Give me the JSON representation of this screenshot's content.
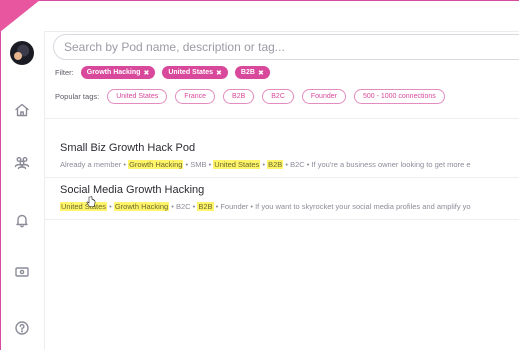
{
  "search": {
    "placeholder": "Search by Pod name, description or tag..."
  },
  "filters": {
    "label": "Filter:",
    "active": [
      "Growth Hacking",
      "United States",
      "B2B"
    ],
    "remove_glyph": "✖"
  },
  "popular": {
    "label": "Popular tags:",
    "tags": [
      "United States",
      "France",
      "B2B",
      "B2C",
      "Founder",
      "500 - 1000 connections"
    ]
  },
  "results": [
    {
      "title": "Small Biz Growth Hack Pod",
      "meta": [
        {
          "text": "Already a member • ",
          "hl": false
        },
        {
          "text": "Growth Hacking",
          "hl": true
        },
        {
          "text": " • SMB • ",
          "hl": false
        },
        {
          "text": "United States",
          "hl": true
        },
        {
          "text": " • ",
          "hl": false
        },
        {
          "text": "B2B",
          "hl": true
        },
        {
          "text": " • B2C • If you're a business owner looking to get more e",
          "hl": false
        }
      ]
    },
    {
      "title": "Social Media Growth Hacking",
      "meta": [
        {
          "text": "United States",
          "hl": true
        },
        {
          "text": " • ",
          "hl": false
        },
        {
          "text": "Growth Hacking",
          "hl": true
        },
        {
          "text": " • B2C • ",
          "hl": false
        },
        {
          "text": "B2B",
          "hl": true
        },
        {
          "text": " • Founder • If you want to skyrocket your social media profiles and amplify yo",
          "hl": false
        }
      ]
    }
  ],
  "sidebar": {
    "icons": [
      "home-icon",
      "community-icon",
      "bell-icon",
      "card-icon",
      "help-icon"
    ]
  },
  "colors": {
    "accent": "#d8489b",
    "highlight": "#fff46a"
  }
}
